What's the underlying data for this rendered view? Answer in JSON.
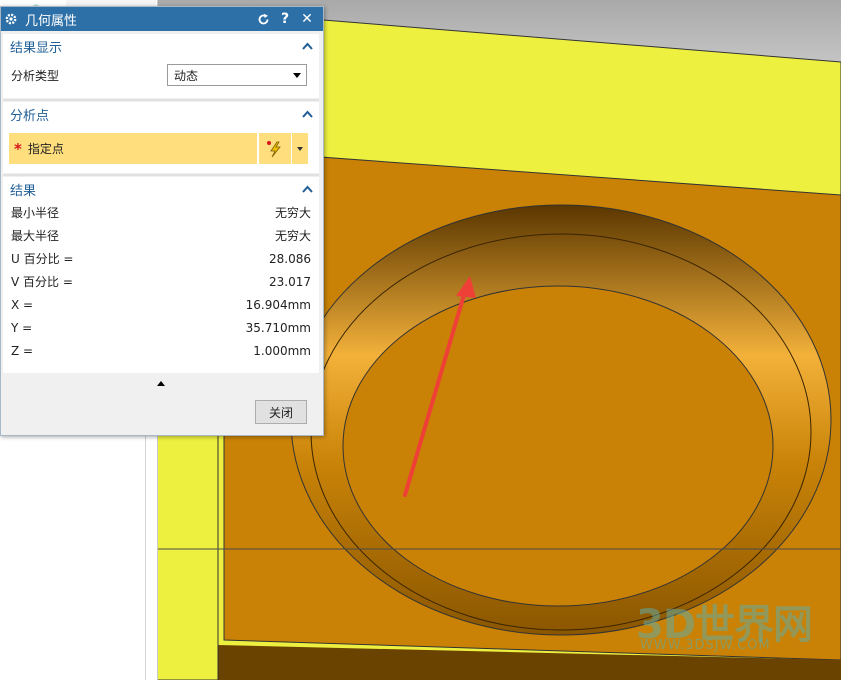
{
  "dialog": {
    "title": "几何属性",
    "title_buttons": {
      "reset_icon": "reset-icon",
      "help_label": "?",
      "close_label": "✕"
    },
    "sections": {
      "display": {
        "header": "结果显示",
        "analysis_type_label": "分析类型",
        "analysis_type_value": "动态"
      },
      "analysis_point": {
        "header": "分析点",
        "required_marker": "*",
        "specify_point_label": "指定点"
      },
      "results": {
        "header": "结果",
        "rows": [
          {
            "label": "最小半径",
            "value": "无穷大"
          },
          {
            "label": "最大半径",
            "value": "无穷大"
          },
          {
            "label": "U 百分比 =",
            "value": "28.086"
          },
          {
            "label": "V 百分比 =",
            "value": "23.017"
          },
          {
            "label": "X =",
            "value": "16.904mm"
          },
          {
            "label": "Y =",
            "value": "35.710mm"
          },
          {
            "label": "Z =",
            "value": "1.000mm"
          }
        ]
      }
    },
    "close_button": "关闭"
  },
  "watermark": {
    "brand": "3D世界网",
    "url": "WWW.3DSJW.COM"
  },
  "colors": {
    "titlebar": "#2d6fa7",
    "section_header": "#1f5e96",
    "required_field": "#fede7d",
    "model_surface": "#c98205",
    "background_plane": "#f0f040",
    "annotation_arrow": "#ee4036"
  }
}
